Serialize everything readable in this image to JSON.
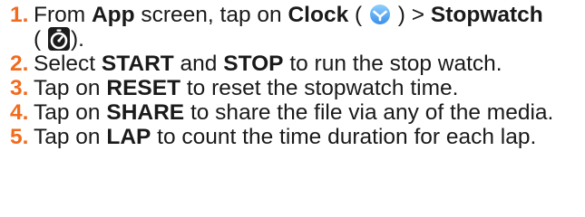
{
  "accent_color": "#f26b1d",
  "steps": [
    {
      "num": "1.",
      "t1": "From ",
      "b1": "App",
      "t2": " screen, tap on ",
      "b2": "Clock",
      "t3": " (",
      "icon1": "clock-app-icon",
      "t4": ") > ",
      "b3": "Stopwatch",
      "t5": "(",
      "icon2": "stopwatch-icon",
      "t6": ")."
    },
    {
      "num": "2.",
      "t1": "Select ",
      "b1": "START",
      "t2": " and ",
      "b2": "STOP",
      "t3": " to run the stop watch."
    },
    {
      "num": "3.",
      "t1": "Tap on ",
      "b1": "RESET",
      "t2": " to reset the stopwatch time."
    },
    {
      "num": "4.",
      "t1": "Tap on ",
      "b1": "SHARE",
      "t2": " to share the file via any of the media."
    },
    {
      "num": "5.",
      "t1": "Tap on ",
      "b1": "LAP",
      "t2": " to count the time duration for each lap."
    }
  ]
}
